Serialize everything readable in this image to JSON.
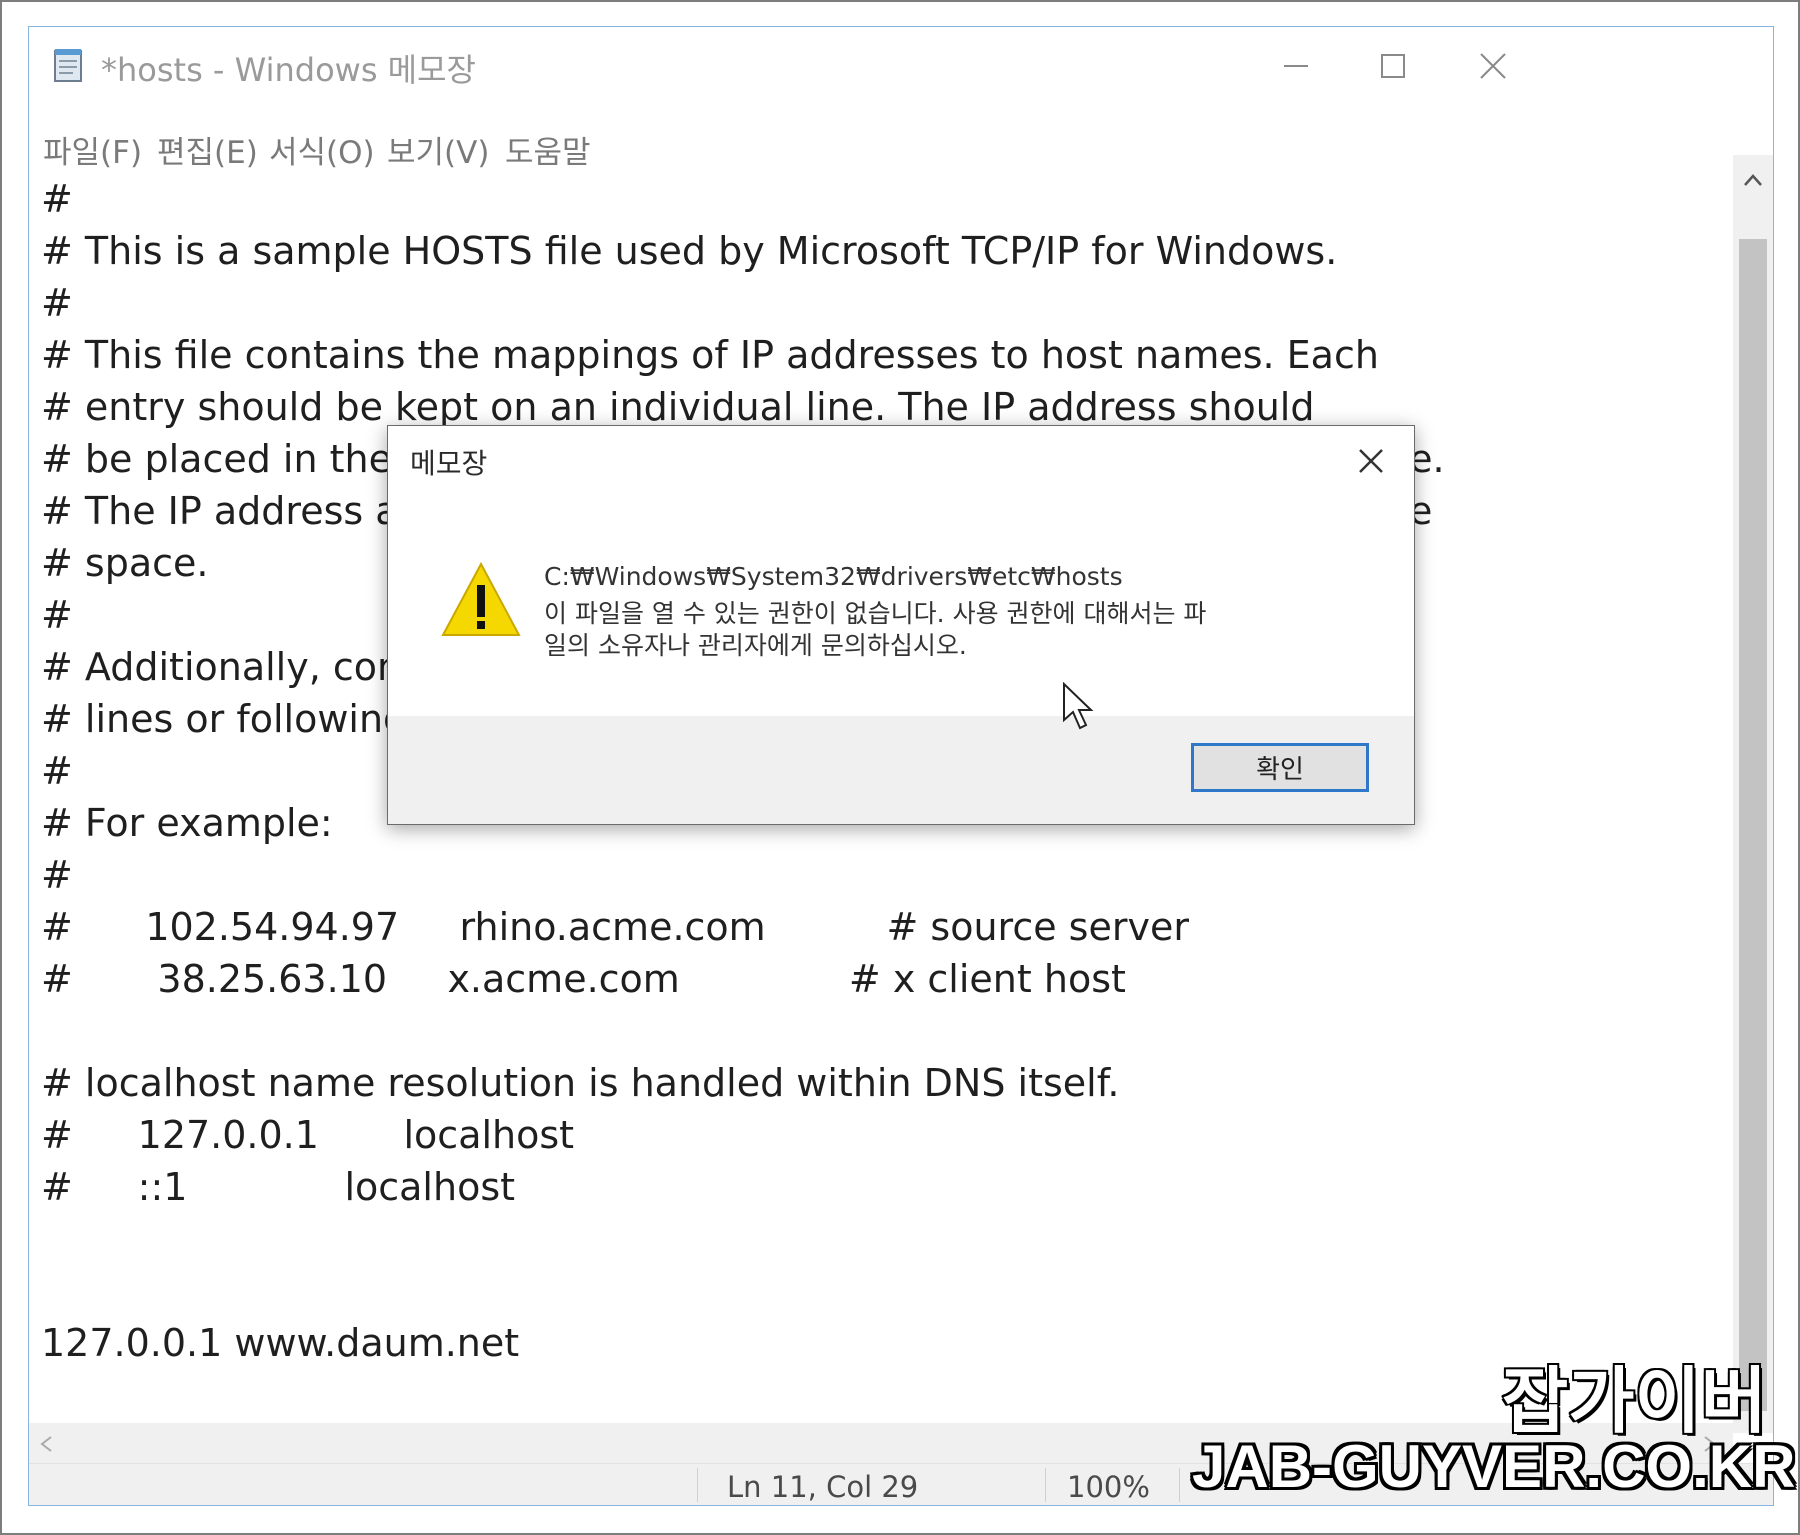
{
  "window": {
    "title": "*hosts - Windows 메모장",
    "menu": [
      "파일(F)",
      "편집(E)",
      "서식(O)",
      "보기(V)",
      "도움말"
    ]
  },
  "editor": {
    "lines": [
      "#",
      "# This is a sample HOSTS file used by Microsoft TCP/IP for Windows.",
      "#",
      "# This file contains the mappings of IP addresses to host names. Each",
      "# entry should be kept on an individual line. The IP address should",
      "# be placed in the first column followed by the corresponding host name.",
      "# The IP address and the host name should be separated by at least one",
      "# space.",
      "#",
      "# Additionally, comments (such as these) may be inserted on individual",
      "# lines or following the machine name denoted by a '#' symbol.",
      "#",
      "# For example:",
      "#",
      "#      102.54.94.97     rhino.acme.com          # source server",
      "#       38.25.63.10     x.acme.com              # x client host",
      "",
      "# localhost name resolution is handled within DNS itself.",
      "#\t127.0.0.1       localhost",
      "#\t::1             localhost",
      "",
      "",
      "127.0.0.1 www.daum.net"
    ]
  },
  "status": {
    "position": "Ln 11, Col 29",
    "zoom": "100%"
  },
  "dialog": {
    "title": "메모장",
    "path": "C:₩Windows₩System32₩drivers₩etc₩hosts",
    "message_line1": "이 파일을 열 수 있는 권한이 없습니다. 사용 권한에 대해서는 파",
    "message_line2": "일의 소유자나 관리자에게 문의하십시오.",
    "ok_label": "확인"
  },
  "watermark": {
    "korean": "잡가이버",
    "url": "JAB-GUYVER.CO.KR"
  },
  "colors": {
    "accent": "#2f77c9",
    "warning": "#f5d800"
  }
}
